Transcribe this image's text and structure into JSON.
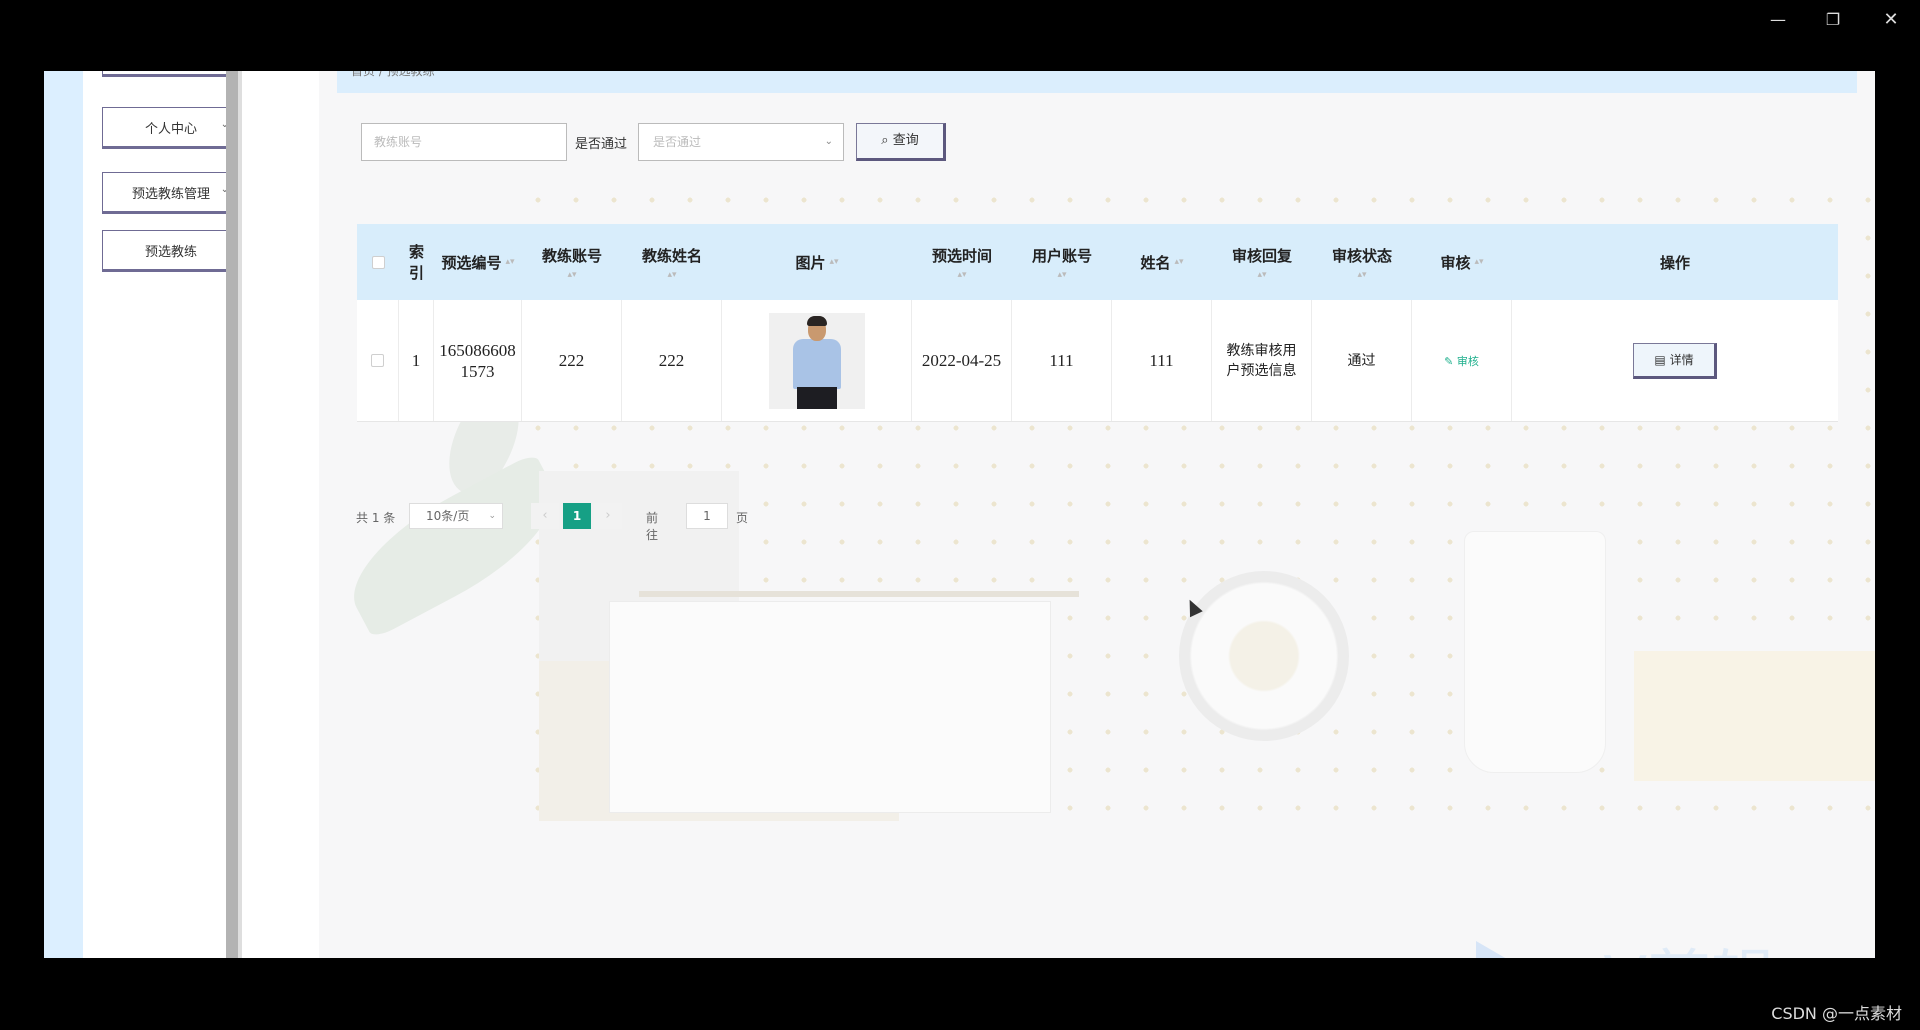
{
  "window_controls": {
    "minimize": "—",
    "maximize": "❐",
    "close": "✕"
  },
  "breadcrumb": "首页 / 预选教练",
  "sidebar": {
    "items": [
      {
        "label": "个人中心",
        "chevron": "⌄"
      },
      {
        "label": "预选教练管理",
        "chevron": "⌄"
      },
      {
        "label": "预选教练"
      }
    ]
  },
  "search": {
    "coach_account_placeholder": "教练账号",
    "pass_label": "是否通过",
    "pass_select_placeholder": "是否通过",
    "select_arrow": "⌄",
    "query_button": "⌕ 查询"
  },
  "table": {
    "sort_icon": "▴▾",
    "columns": [
      "索引",
      "预选编号",
      "教练账号",
      "教练姓名",
      "图片",
      "预选时间",
      "用户账号",
      "姓名",
      "审核回复",
      "审核状态",
      "审核",
      "操作"
    ],
    "rows": [
      {
        "index": "1",
        "preselect_no": "1650866081573",
        "coach_account": "222",
        "coach_name": "222",
        "image": "person-photo",
        "preselect_time": "2022-04-25",
        "user_account": "111",
        "name": "111",
        "audit_reply": "教练审核用户预选信息",
        "audit_status": "通过",
        "audit_link": "✎ 审核",
        "detail_button": "▤ 详情"
      }
    ]
  },
  "pagination": {
    "total": "共 1 条",
    "page_size": "10条/页",
    "prev": "‹",
    "current_page": "1",
    "next": "›",
    "goto_label": "前往",
    "goto_value": "1",
    "page_suffix": "页"
  },
  "watermark": "eV剪辑",
  "footer_credit": "CSDN @一点素材"
}
